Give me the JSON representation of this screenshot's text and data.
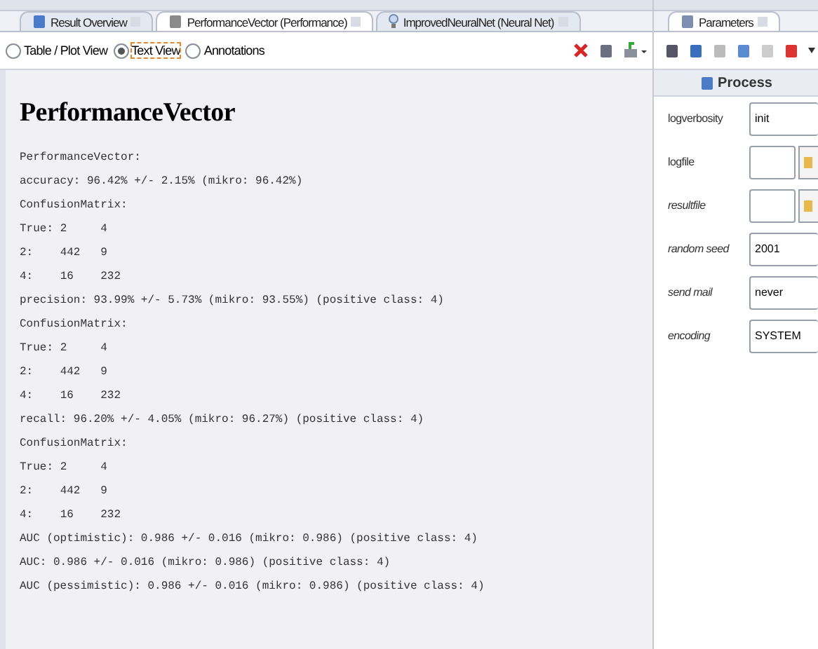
{
  "tabs": [
    {
      "label": "Result Overview",
      "selected": false
    },
    {
      "label": "PerformanceVector (Performance)",
      "selected": true
    },
    {
      "label": "ImprovedNeuralNet (Neural Net)",
      "selected": false
    }
  ],
  "view_options": [
    {
      "label": "Table / Plot View",
      "selected": false
    },
    {
      "label": "Text View",
      "selected": true
    },
    {
      "label": "Annotations",
      "selected": false
    }
  ],
  "result": {
    "title": "PerformanceVector",
    "lines": [
      "PerformanceVector:",
      "accuracy: 96.42% +/- 2.15% (mikro: 96.42%)",
      "ConfusionMatrix:",
      "True:\t2\t4",
      "2:\t442\t9",
      "4:\t16\t232",
      "precision: 93.99% +/- 5.73% (mikro: 93.55%) (positive class: 4)",
      "ConfusionMatrix:",
      "True:\t2\t4",
      "2:\t442\t9",
      "4:\t16\t232",
      "recall: 96.20% +/- 4.05% (mikro: 96.27%) (positive class: 4)",
      "ConfusionMatrix:",
      "True:\t2\t4",
      "2:\t442\t9",
      "4:\t16\t232",
      "AUC (optimistic): 0.986 +/- 0.016 (mikro: 0.986) (positive class: 4)",
      "AUC: 0.986 +/- 0.016 (mikro: 0.986) (positive class: 4)",
      "AUC (pessimistic): 0.986 +/- 0.016 (mikro: 0.986) (positive class: 4)"
    ]
  },
  "parameters_panel": {
    "tab": "Parameters",
    "section": "Process",
    "params": [
      {
        "label": "logverbosity",
        "kind": "select",
        "value": "init",
        "italic": false
      },
      {
        "label": "logfile",
        "kind": "file",
        "italic": false
      },
      {
        "label": "resultfile",
        "kind": "file",
        "italic": true
      },
      {
        "label": "random seed",
        "kind": "text",
        "value": "2001",
        "italic": true
      },
      {
        "label": "send mail",
        "kind": "select",
        "value": "never",
        "italic": true
      },
      {
        "label": "encoding",
        "kind": "select",
        "value": "SYSTEM",
        "italic": true
      }
    ]
  }
}
